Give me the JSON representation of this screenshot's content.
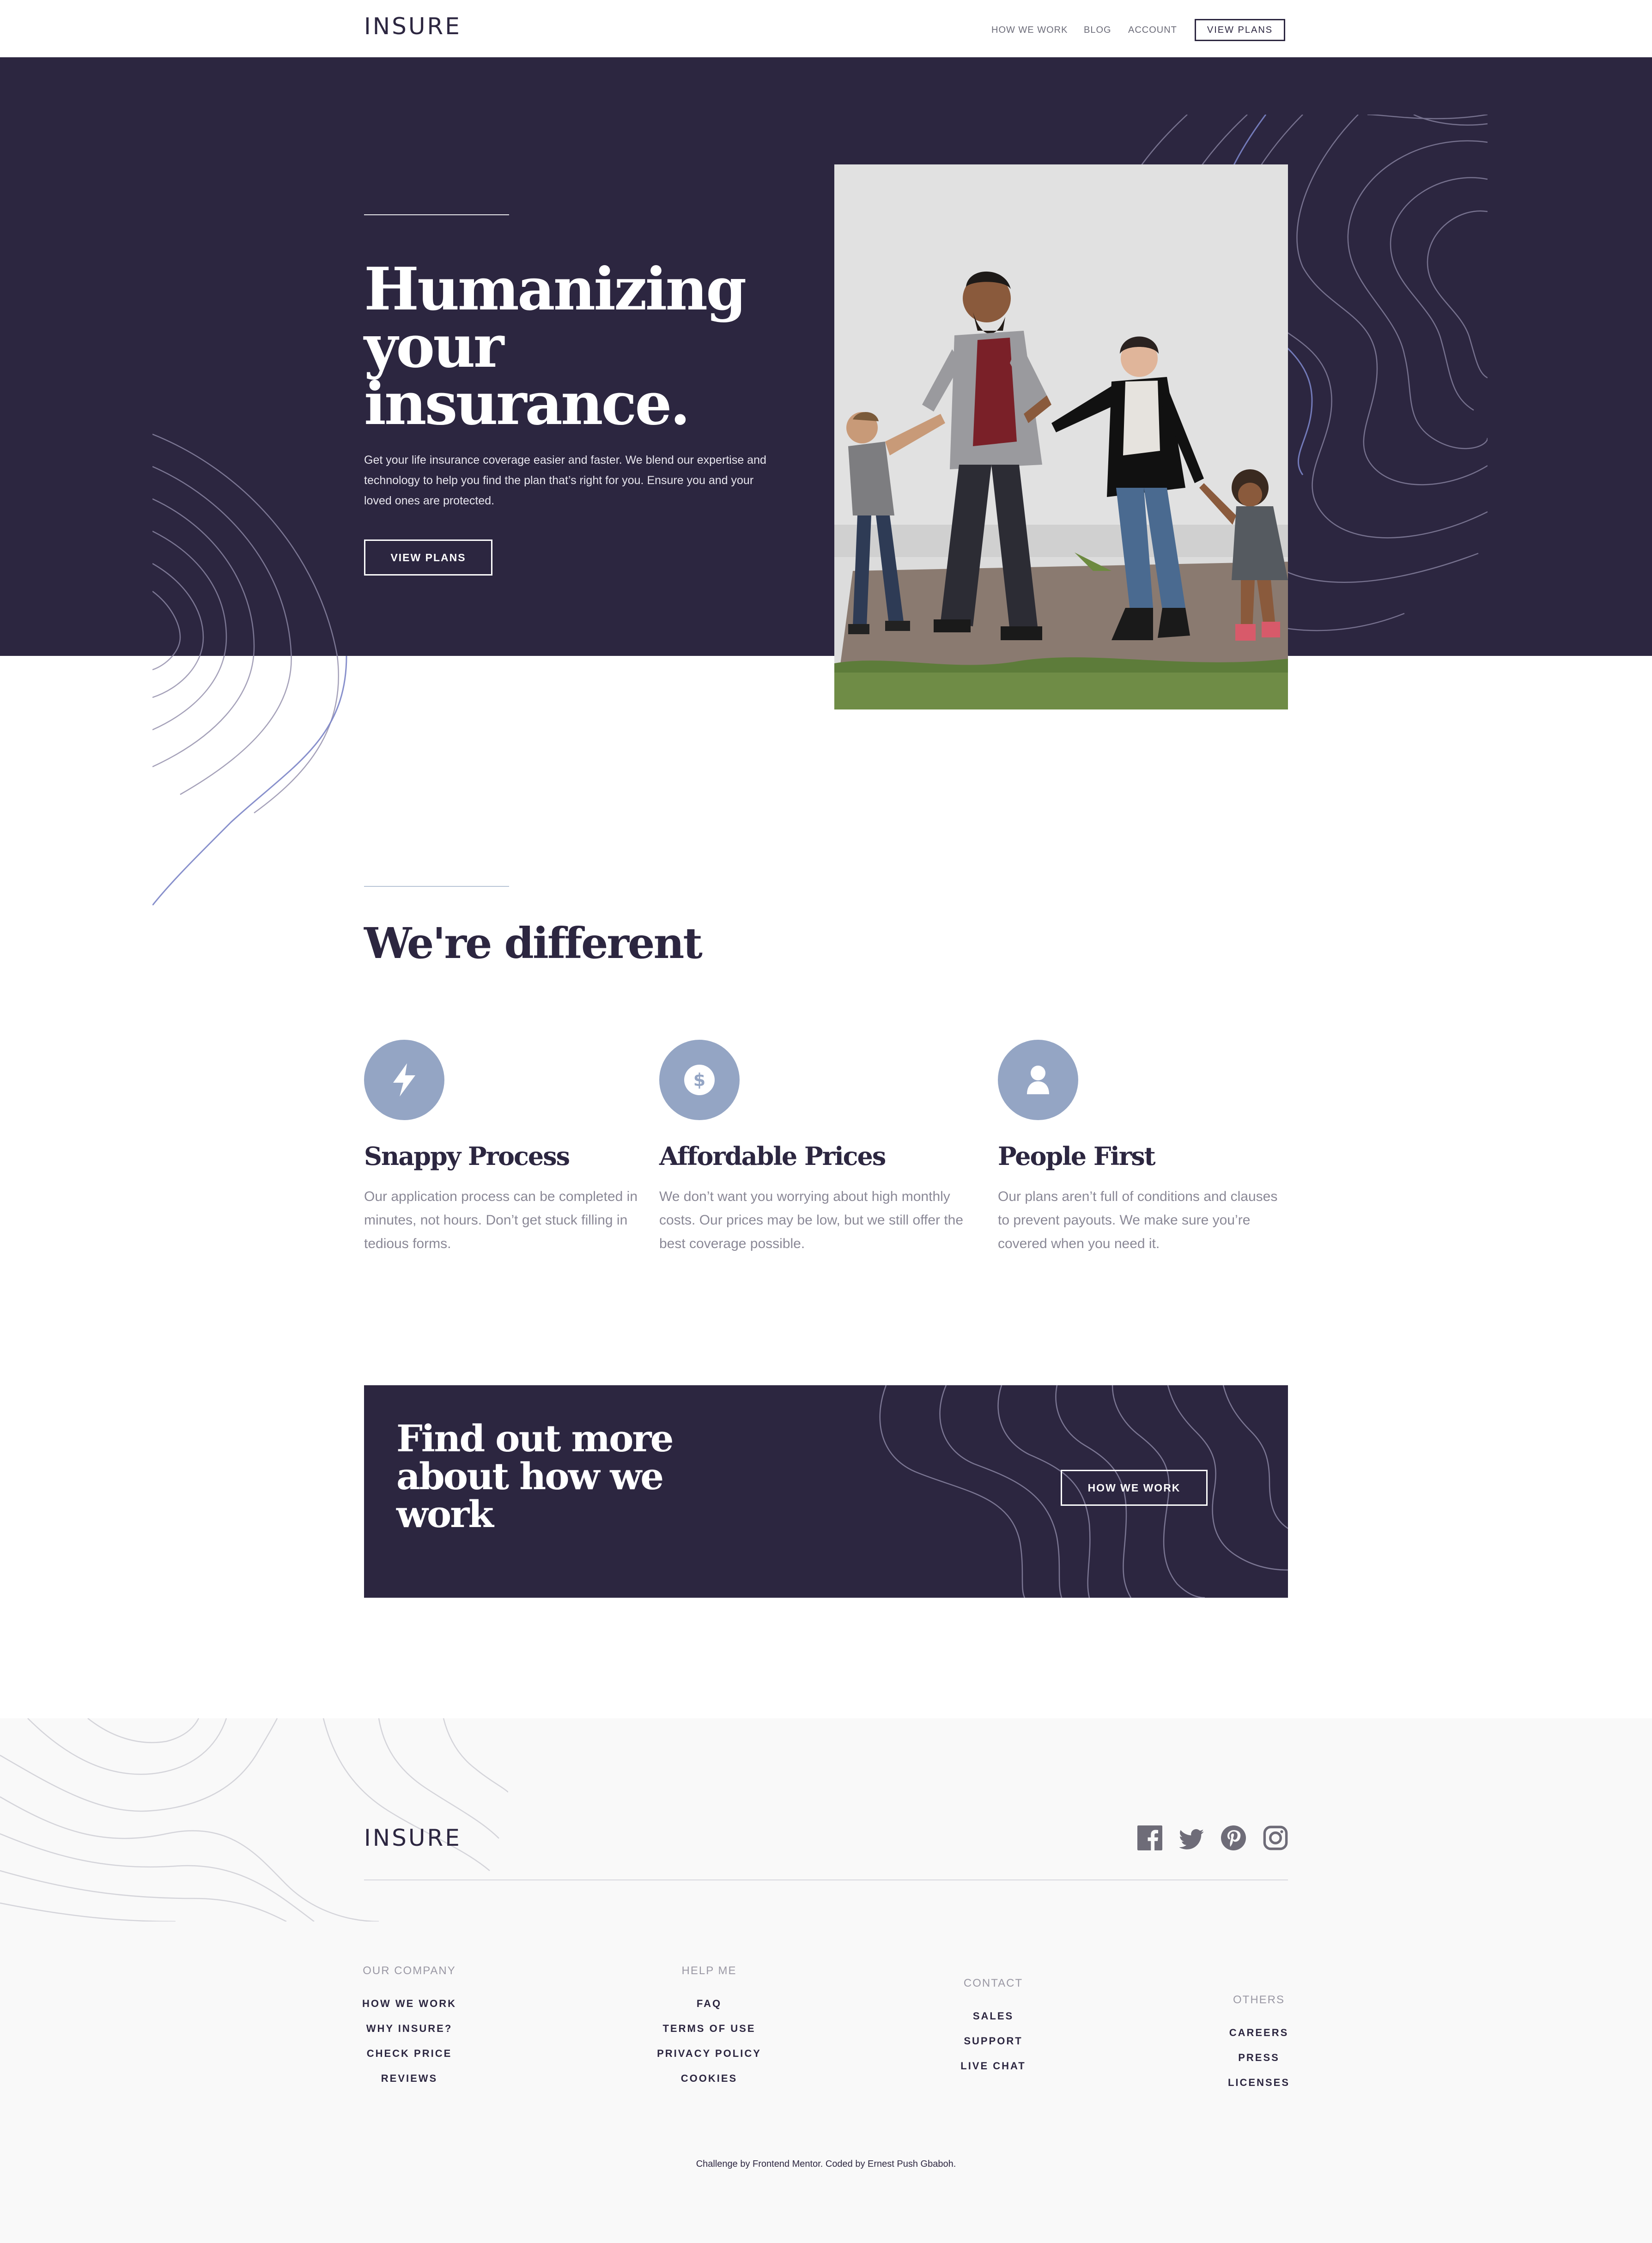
{
  "brand": {
    "logo": "INSURE",
    "primary_color": "#2c2640",
    "accent_color": "#94a5c4"
  },
  "nav": {
    "links": [
      "HOW WE WORK",
      "BLOG",
      "ACCOUNT"
    ],
    "cta": "VIEW PLANS"
  },
  "hero": {
    "title_line1": "Humanizing",
    "title_line2": "your",
    "title_line3": "insurance.",
    "description": "Get your life insurance coverage easier and faster. We blend our expertise and technology to help you find the plan that’s right for you. Ensure you and your loved ones are protected.",
    "button": "VIEW PLANS"
  },
  "features": {
    "title": "We're different",
    "items": [
      {
        "icon": "lightning-icon",
        "title": "Snappy Process",
        "text": "Our application process can be completed in minutes, not hours. Don’t get stuck filling in tedious forms."
      },
      {
        "icon": "dollar-icon",
        "title": "Affordable Prices",
        "text": "We don’t want you worrying about high monthly costs. Our prices may be low, but we still offer the best coverage possible."
      },
      {
        "icon": "person-icon",
        "title": "People First",
        "text": "Our plans aren’t full of conditions and clauses to prevent payouts. We make sure you’re covered when you need it."
      }
    ]
  },
  "cta": {
    "title_line1": "Find out more",
    "title_line2": "about how we",
    "title_line3": "work",
    "button": "HOW WE WORK"
  },
  "footer": {
    "logo": "INSURE",
    "social_icons": [
      "facebook-icon",
      "twitter-icon",
      "pinterest-icon",
      "instagram-icon"
    ],
    "columns": [
      {
        "heading": "OUR COMPANY",
        "links": [
          "HOW WE WORK",
          "WHY INSURE?",
          "CHECK PRICE",
          "REVIEWS"
        ]
      },
      {
        "heading": "HELP ME",
        "links": [
          "FAQ",
          "TERMS OF USE",
          "PRIVACY POLICY",
          "COOKIES"
        ]
      },
      {
        "heading": "CONTACT",
        "links": [
          "SALES",
          "SUPPORT",
          "LIVE CHAT"
        ]
      },
      {
        "heading": "OTHERS",
        "links": [
          "CAREERS",
          "PRESS",
          "LICENSES"
        ]
      }
    ],
    "attribution": "Challenge by Frontend Mentor. Coded by Ernest Push Gbaboh."
  }
}
